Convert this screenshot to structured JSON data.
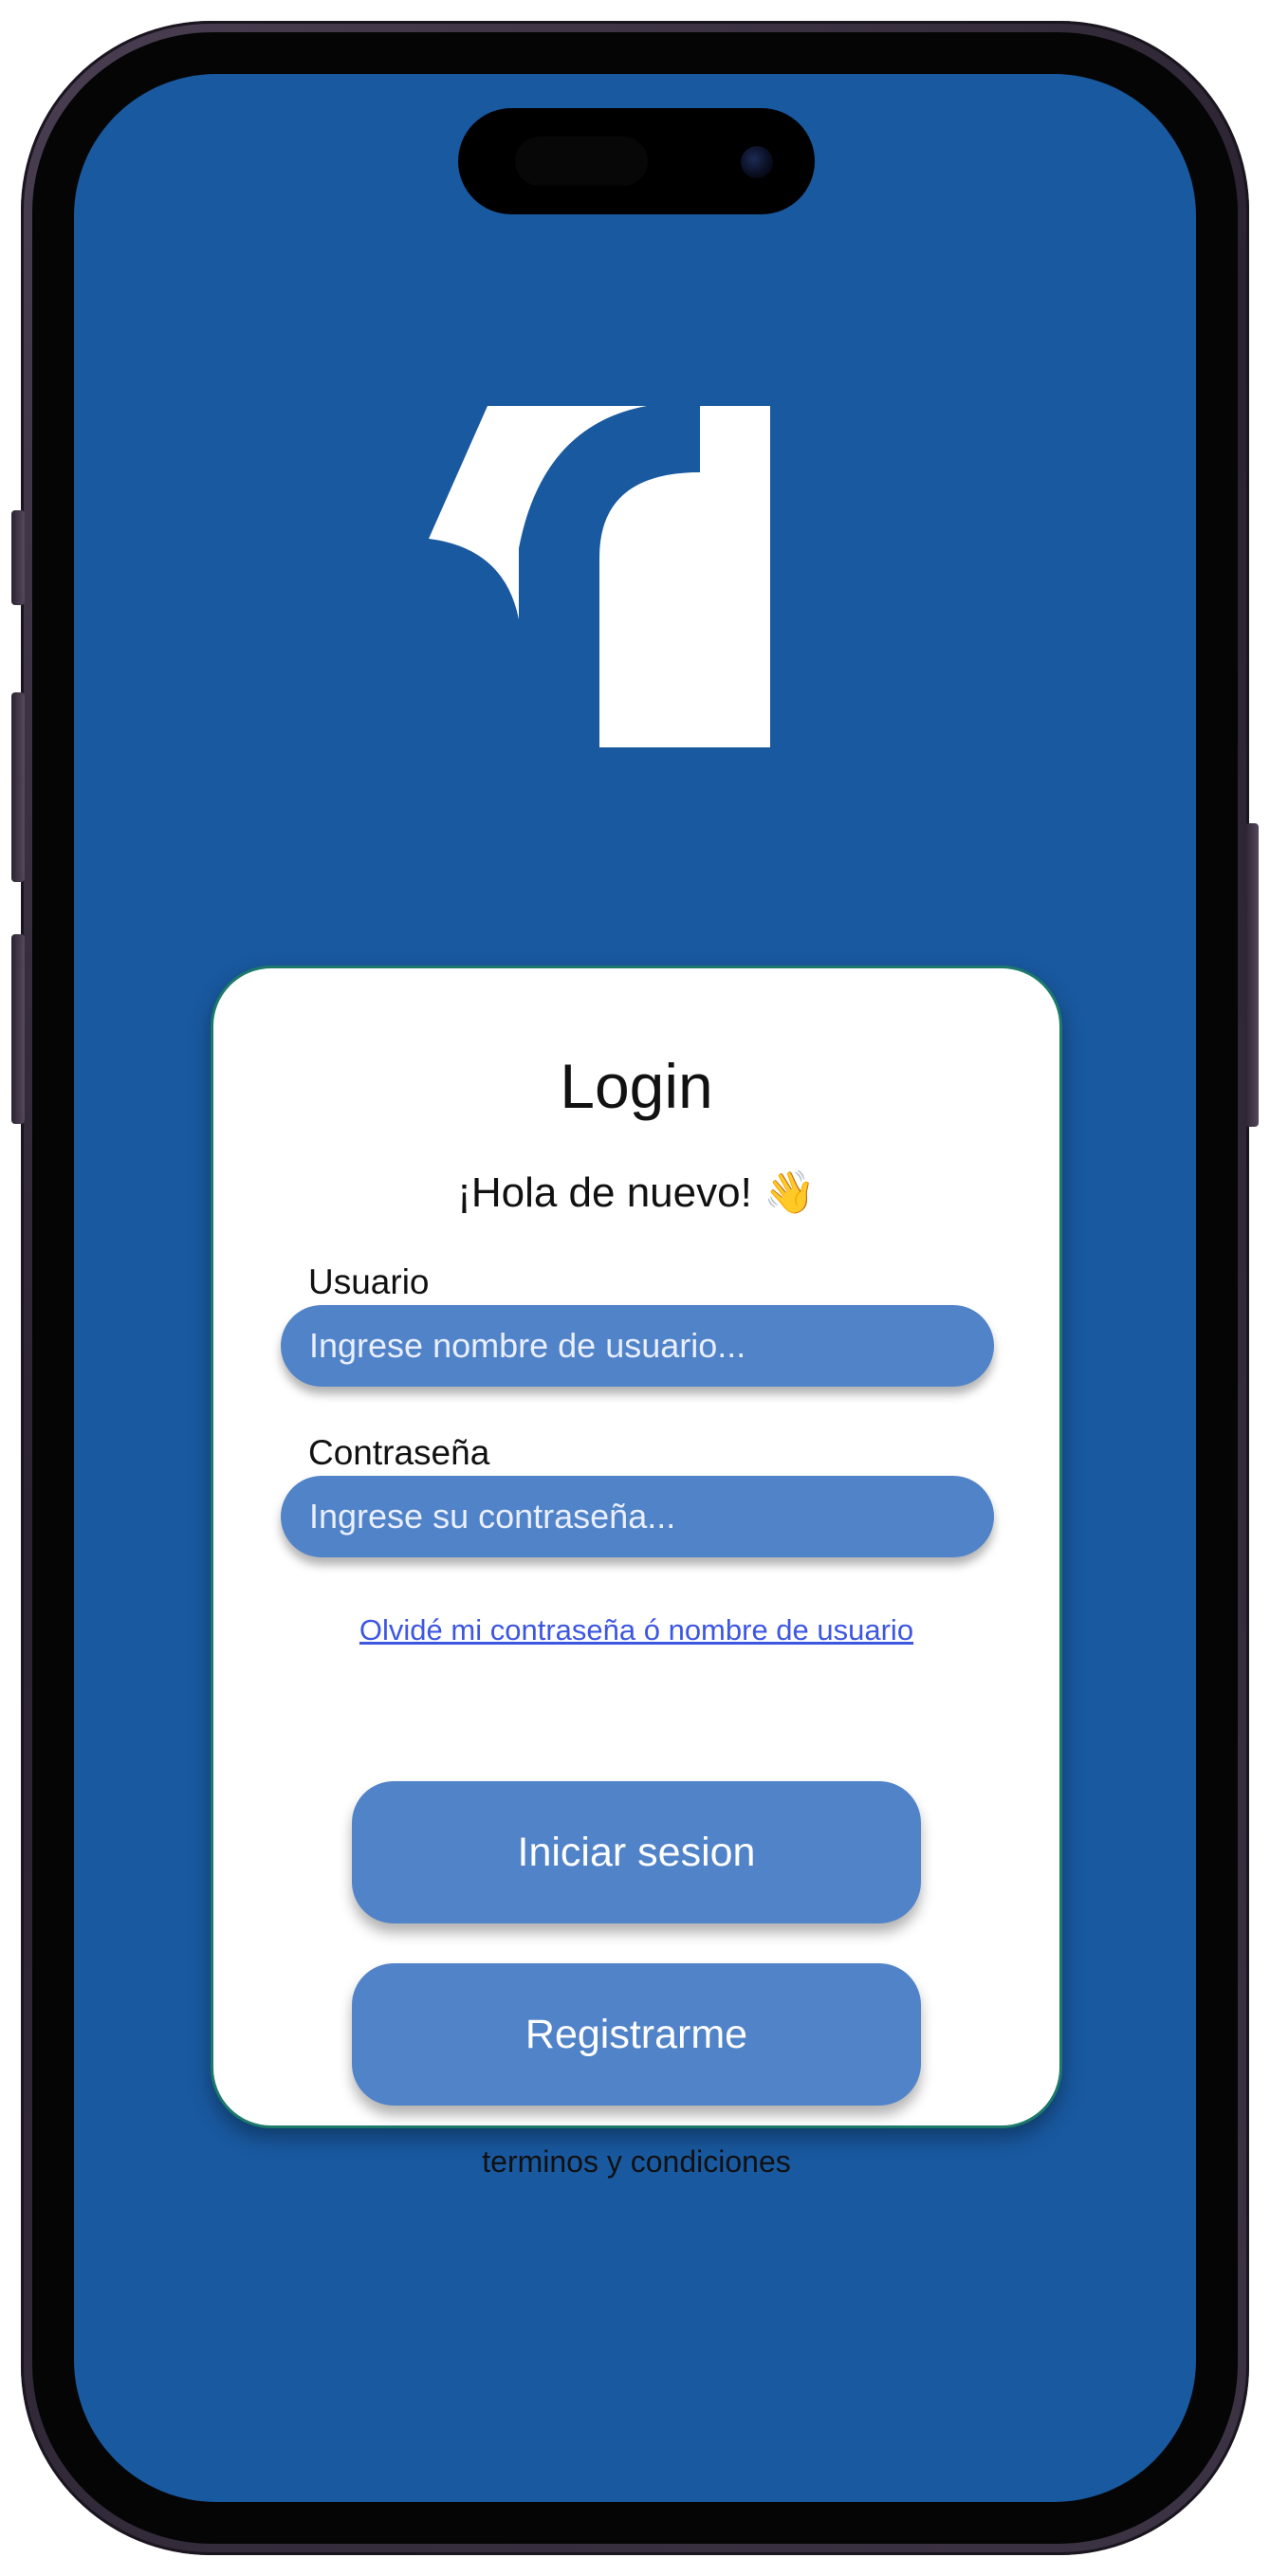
{
  "screen": {
    "background_color": "#1959a0",
    "logo_icon": "app-logo-icon"
  },
  "login_card": {
    "title": "Login",
    "greeting": "¡Hola de nuevo! 👋",
    "username": {
      "label": "Usuario",
      "placeholder": "Ingrese nombre de usuario...",
      "value": ""
    },
    "password": {
      "label": "Contraseña",
      "placeholder": "Ingrese su contraseña...",
      "value": ""
    },
    "forgot_link": "Olvidé mi contraseña ó nombre de usuario",
    "login_button": "Iniciar sesion",
    "register_button": "Registrarme",
    "terms_link": "terminos y condiciones"
  },
  "colors": {
    "accent": "#5183c9",
    "card_border": "#1d7a6a",
    "link": "#3d57e0"
  }
}
